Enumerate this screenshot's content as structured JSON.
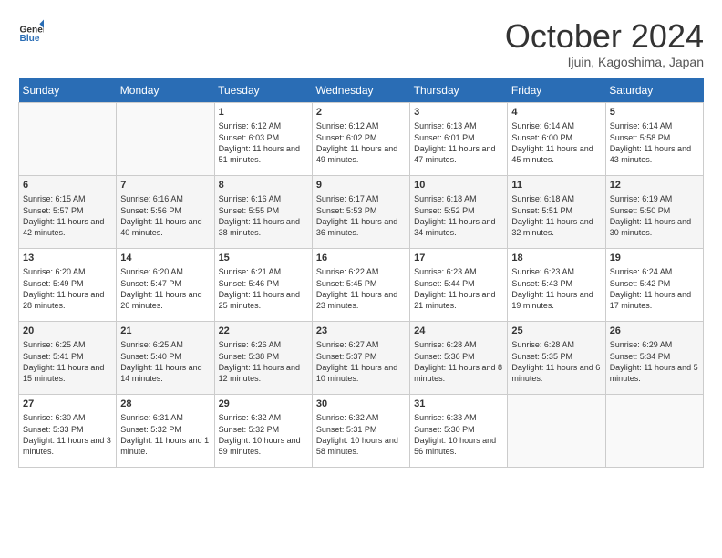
{
  "logo": {
    "general": "General",
    "blue": "Blue"
  },
  "title": "October 2024",
  "subtitle": "Ijuin, Kagoshima, Japan",
  "days_of_week": [
    "Sunday",
    "Monday",
    "Tuesday",
    "Wednesday",
    "Thursday",
    "Friday",
    "Saturday"
  ],
  "weeks": [
    [
      {
        "day": "",
        "content": ""
      },
      {
        "day": "",
        "content": ""
      },
      {
        "day": "1",
        "content": "Sunrise: 6:12 AM\nSunset: 6:03 PM\nDaylight: 11 hours and 51 minutes."
      },
      {
        "day": "2",
        "content": "Sunrise: 6:12 AM\nSunset: 6:02 PM\nDaylight: 11 hours and 49 minutes."
      },
      {
        "day": "3",
        "content": "Sunrise: 6:13 AM\nSunset: 6:01 PM\nDaylight: 11 hours and 47 minutes."
      },
      {
        "day": "4",
        "content": "Sunrise: 6:14 AM\nSunset: 6:00 PM\nDaylight: 11 hours and 45 minutes."
      },
      {
        "day": "5",
        "content": "Sunrise: 6:14 AM\nSunset: 5:58 PM\nDaylight: 11 hours and 43 minutes."
      }
    ],
    [
      {
        "day": "6",
        "content": "Sunrise: 6:15 AM\nSunset: 5:57 PM\nDaylight: 11 hours and 42 minutes."
      },
      {
        "day": "7",
        "content": "Sunrise: 6:16 AM\nSunset: 5:56 PM\nDaylight: 11 hours and 40 minutes."
      },
      {
        "day": "8",
        "content": "Sunrise: 6:16 AM\nSunset: 5:55 PM\nDaylight: 11 hours and 38 minutes."
      },
      {
        "day": "9",
        "content": "Sunrise: 6:17 AM\nSunset: 5:53 PM\nDaylight: 11 hours and 36 minutes."
      },
      {
        "day": "10",
        "content": "Sunrise: 6:18 AM\nSunset: 5:52 PM\nDaylight: 11 hours and 34 minutes."
      },
      {
        "day": "11",
        "content": "Sunrise: 6:18 AM\nSunset: 5:51 PM\nDaylight: 11 hours and 32 minutes."
      },
      {
        "day": "12",
        "content": "Sunrise: 6:19 AM\nSunset: 5:50 PM\nDaylight: 11 hours and 30 minutes."
      }
    ],
    [
      {
        "day": "13",
        "content": "Sunrise: 6:20 AM\nSunset: 5:49 PM\nDaylight: 11 hours and 28 minutes."
      },
      {
        "day": "14",
        "content": "Sunrise: 6:20 AM\nSunset: 5:47 PM\nDaylight: 11 hours and 26 minutes."
      },
      {
        "day": "15",
        "content": "Sunrise: 6:21 AM\nSunset: 5:46 PM\nDaylight: 11 hours and 25 minutes."
      },
      {
        "day": "16",
        "content": "Sunrise: 6:22 AM\nSunset: 5:45 PM\nDaylight: 11 hours and 23 minutes."
      },
      {
        "day": "17",
        "content": "Sunrise: 6:23 AM\nSunset: 5:44 PM\nDaylight: 11 hours and 21 minutes."
      },
      {
        "day": "18",
        "content": "Sunrise: 6:23 AM\nSunset: 5:43 PM\nDaylight: 11 hours and 19 minutes."
      },
      {
        "day": "19",
        "content": "Sunrise: 6:24 AM\nSunset: 5:42 PM\nDaylight: 11 hours and 17 minutes."
      }
    ],
    [
      {
        "day": "20",
        "content": "Sunrise: 6:25 AM\nSunset: 5:41 PM\nDaylight: 11 hours and 15 minutes."
      },
      {
        "day": "21",
        "content": "Sunrise: 6:25 AM\nSunset: 5:40 PM\nDaylight: 11 hours and 14 minutes."
      },
      {
        "day": "22",
        "content": "Sunrise: 6:26 AM\nSunset: 5:38 PM\nDaylight: 11 hours and 12 minutes."
      },
      {
        "day": "23",
        "content": "Sunrise: 6:27 AM\nSunset: 5:37 PM\nDaylight: 11 hours and 10 minutes."
      },
      {
        "day": "24",
        "content": "Sunrise: 6:28 AM\nSunset: 5:36 PM\nDaylight: 11 hours and 8 minutes."
      },
      {
        "day": "25",
        "content": "Sunrise: 6:28 AM\nSunset: 5:35 PM\nDaylight: 11 hours and 6 minutes."
      },
      {
        "day": "26",
        "content": "Sunrise: 6:29 AM\nSunset: 5:34 PM\nDaylight: 11 hours and 5 minutes."
      }
    ],
    [
      {
        "day": "27",
        "content": "Sunrise: 6:30 AM\nSunset: 5:33 PM\nDaylight: 11 hours and 3 minutes."
      },
      {
        "day": "28",
        "content": "Sunrise: 6:31 AM\nSunset: 5:32 PM\nDaylight: 11 hours and 1 minute."
      },
      {
        "day": "29",
        "content": "Sunrise: 6:32 AM\nSunset: 5:32 PM\nDaylight: 10 hours and 59 minutes."
      },
      {
        "day": "30",
        "content": "Sunrise: 6:32 AM\nSunset: 5:31 PM\nDaylight: 10 hours and 58 minutes."
      },
      {
        "day": "31",
        "content": "Sunrise: 6:33 AM\nSunset: 5:30 PM\nDaylight: 10 hours and 56 minutes."
      },
      {
        "day": "",
        "content": ""
      },
      {
        "day": "",
        "content": ""
      }
    ]
  ]
}
